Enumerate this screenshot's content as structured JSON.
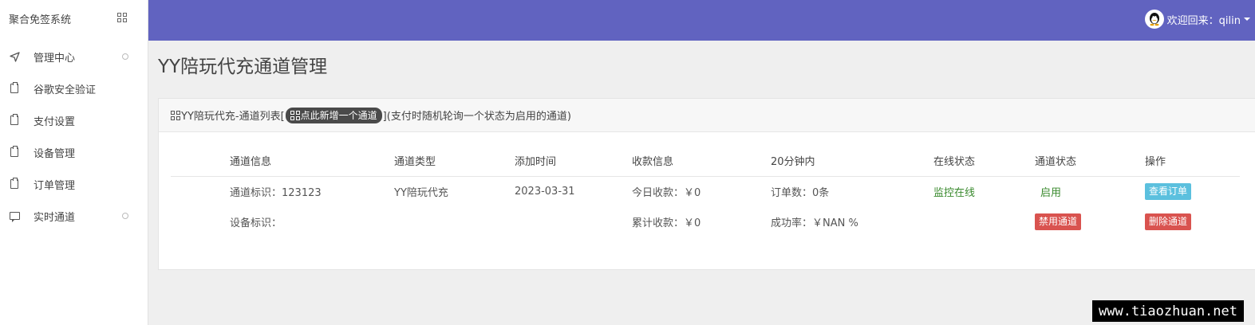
{
  "sidebar": {
    "brand": "聚合免签系统",
    "items": [
      {
        "label": "管理中心",
        "icon": "send-icon",
        "has_dot": true
      },
      {
        "label": "谷歌安全验证",
        "icon": "clipboard-icon"
      },
      {
        "label": "支付设置",
        "icon": "clipboard-icon"
      },
      {
        "label": "设备管理",
        "icon": "clipboard-icon"
      },
      {
        "label": "订单管理",
        "icon": "clipboard-icon"
      },
      {
        "label": "实时通道",
        "icon": "message-icon",
        "has_dot": true
      }
    ]
  },
  "topbar": {
    "welcome": "欢迎回来：qilin",
    "accent_color": "#6163c0"
  },
  "page": {
    "title": "YY陪玩代充通道管理"
  },
  "panel": {
    "head_prefix": "YY陪玩代充-通道列表[",
    "add_button": "点此新增一个通道",
    "head_suffix": "](支付时随机轮询一个状态为启用的通道)",
    "columns": [
      "通道信息",
      "通道类型",
      "添加时间",
      "收款信息",
      "20分钟内",
      "在线状态",
      "通道状态",
      "操作"
    ],
    "row": {
      "channel_id": "通道标识：123123",
      "device_id": "设备标识：",
      "type": "YY陪玩代充",
      "added": "2023-03-31",
      "today_income": "今日收款：￥0",
      "total_income": "累计收款：￥0",
      "orders": "订单数：0条",
      "success_rate": "成功率：￥NAN %",
      "online_status": "监控在线",
      "channel_status": "启用",
      "view_orders": "查看订单",
      "disable": "禁用通道",
      "delete": "删除通道"
    }
  },
  "watermark": "www.tiaozhuan.net"
}
